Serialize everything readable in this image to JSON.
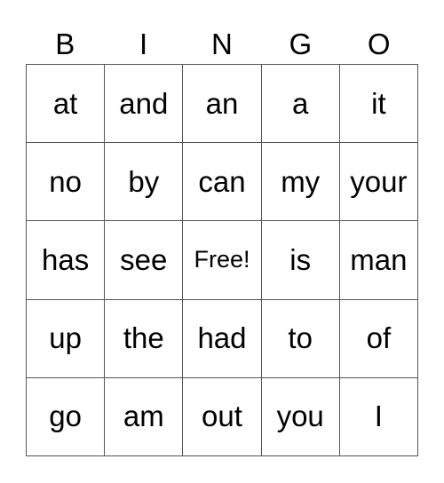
{
  "title_letters": [
    "B",
    "I",
    "N",
    "G",
    "O"
  ],
  "rows": [
    [
      "at",
      "and",
      "an",
      "a",
      "it"
    ],
    [
      "no",
      "by",
      "can",
      "my",
      "your"
    ],
    [
      "has",
      "see",
      "Free!",
      "is",
      "man"
    ],
    [
      "up",
      "the",
      "had",
      "to",
      "of"
    ],
    [
      "go",
      "am",
      "out",
      "you",
      "I"
    ]
  ],
  "free_label": "Free!"
}
